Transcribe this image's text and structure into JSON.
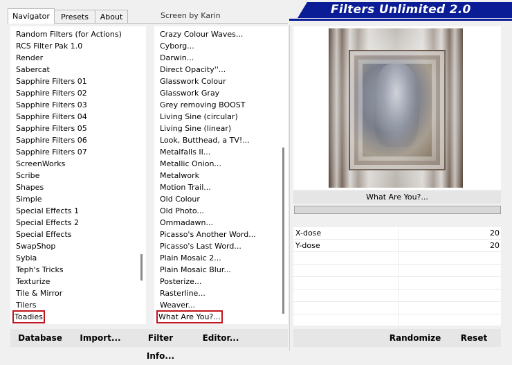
{
  "tabs": [
    {
      "label": "Navigator",
      "active": true
    },
    {
      "label": "Presets",
      "active": false
    },
    {
      "label": "About",
      "active": false
    }
  ],
  "screen_by": "Screen by Karin",
  "banner": {
    "title": "Filters Unlimited 2.0",
    "color": "#0a1c96"
  },
  "categories": [
    "Random Filters (for Actions)",
    "RCS Filter Pak 1.0",
    "Render",
    "Sabercat",
    "Sapphire Filters 01",
    "Sapphire Filters 02",
    "Sapphire Filters 03",
    "Sapphire Filters 04",
    "Sapphire Filters 05",
    "Sapphire Filters 06",
    "Sapphire Filters 07",
    "ScreenWorks",
    "Scribe",
    "Shapes",
    "Simple",
    "Special Effects 1",
    "Special Effects 2",
    "Special Effects",
    "SwapShop",
    "Sybia",
    "Teph's Tricks",
    "Texturize",
    "Tile & Mirror",
    "Tilers",
    "Toadies"
  ],
  "selected_category": "Toadies",
  "filters": [
    "Crazy Colour Waves...",
    "Cyborg...",
    "Darwin...",
    "Direct Opacity''...",
    "Glasswork Colour",
    "Glasswork Gray",
    "Grey removing BOOST",
    "Living Sine (circular)",
    "Living Sine (linear)",
    "Look, Butthead, a TV!...",
    "Metalfalls II...",
    "Metallic Onion...",
    "Metalwork",
    "Motion Trail...",
    "Old Colour",
    "Old Photo...",
    "Ommadawn...",
    "Picasso's Another Word...",
    "Picasso's Last Word...",
    "Plain Mosaic 2...",
    "Plain Mosaic Blur...",
    "Posterize...",
    "Rasterline...",
    "Weaver...",
    "What Are You?..."
  ],
  "selected_filter": "What Are You?...",
  "preview": {
    "filter_name": "What Are You?..."
  },
  "params": [
    {
      "name": "X-dose",
      "value": "20"
    },
    {
      "name": "Y-dose",
      "value": "20"
    }
  ],
  "buttons": {
    "database": "Database",
    "import": "Import...",
    "filter_info": "Filter Info...",
    "editor": "Editor...",
    "randomize": "Randomize",
    "reset": "Reset"
  },
  "highlight_color": "#c0141c"
}
